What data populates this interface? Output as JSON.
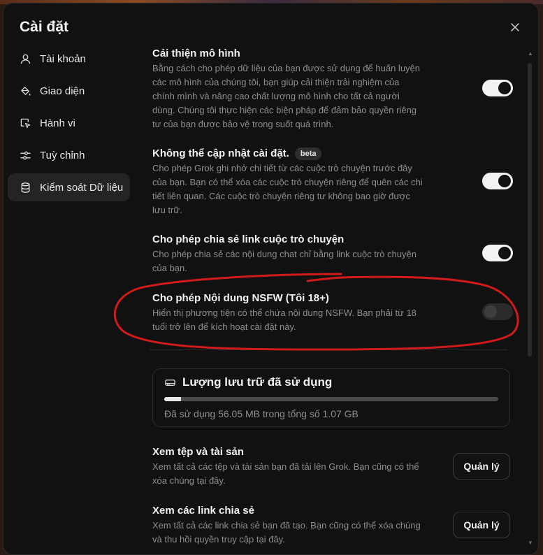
{
  "dialog": {
    "title": "Cài đặt",
    "close_icon": "close-icon"
  },
  "sidebar": {
    "items": [
      {
        "label": "Tài khoản",
        "icon": "user-icon",
        "active": false
      },
      {
        "label": "Giao diện",
        "icon": "paint-bucket-icon",
        "active": false
      },
      {
        "label": "Hành vi",
        "icon": "cursor-icon",
        "active": false
      },
      {
        "label": "Tuỳ chỉnh",
        "icon": "sliders-icon",
        "active": false
      },
      {
        "label": "Kiểm soát Dữ liệu",
        "icon": "database-icon",
        "active": true
      }
    ]
  },
  "settings": [
    {
      "title": "Cải thiện mô hình",
      "desc": "Bằng cách cho phép dữ liệu của bạn được sử dụng để huấn luyện các mô hình của chúng tôi, bạn giúp cải thiện trải nghiệm của chính mình và nâng cao chất lượng mô hình cho tất cả người dùng. Chúng tôi thực hiện các biện pháp để đảm bảo quyền riêng tư của bạn được bảo vệ trong suốt quá trình.",
      "enabled": true
    },
    {
      "title": "Không thể cập nhật cài đặt.",
      "badge": "beta",
      "desc": "Cho phép Grok ghi nhớ chi tiết từ các cuộc trò chuyện trước đây của bạn. Bạn có thể xóa các cuộc trò chuyện riêng để quên các chi tiết liên quan. Các cuộc trò chuyện riêng tư không bao giờ được lưu trữ.",
      "enabled": true
    },
    {
      "title": "Cho phép chia sẻ link cuộc trò chuyện",
      "desc": "Cho phép chia sẻ các nội dung chat chỉ bằng link cuộc trò chuyện của bạn.",
      "enabled": true
    },
    {
      "title": "Cho phép Nội dung NSFW (Tôi 18+)",
      "desc": "Hiển thị phương tiện có thể chứa nội dung NSFW. Bạn phải từ 18 tuổi trở lên để kích hoạt cài đặt này.",
      "enabled": false
    }
  ],
  "storage": {
    "icon": "hard-drive-icon",
    "title": "Lượng lưu trữ đã sử dụng",
    "usage_text": "Đã sử dụng 56.05 MB trong tổng số 1.07 GB",
    "used_fraction": 0.051
  },
  "manage_rows": [
    {
      "title": "Xem tệp và tài sản",
      "desc": "Xem tất cả các tệp và tài sản bạn đã tải lên Grok. Bạn cũng có thể xóa chúng tại đây.",
      "button": "Quản lý"
    },
    {
      "title": "Xem các link chia sẻ",
      "desc": "Xem tất cả các link chia sẻ bạn đã tạo. Bạn cũng có thể xóa chúng và thu hồi quyền truy cập tại đây.",
      "button": "Quản lý"
    }
  ],
  "colors": {
    "annotation": "#d11a1a",
    "toggle_on": "#f2f2f2",
    "toggle_off": "#2a2a2c"
  }
}
